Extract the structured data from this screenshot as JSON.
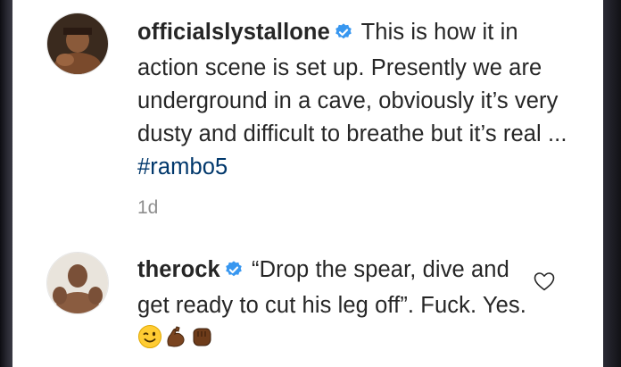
{
  "comments": [
    {
      "username": "officialslystallone",
      "text": "This is how it in action scene is set up. Presently we are underground in a cave, obviously it’s very dusty and difficult to breathe but it’s real ...",
      "hashtag": "#rambo5",
      "time": "1d"
    },
    {
      "username": "therock",
      "text": "“Drop the spear, dive and get ready to cut his leg off”. Fuck. Yes.",
      "emojis": [
        "winking-face-emoji",
        "flexed-biceps-emoji",
        "oncoming-fist-emoji"
      ]
    }
  ],
  "colors": {
    "verified_badge": "#3897f0",
    "hashtag": "#00376b",
    "timestamp": "#8e8e8e",
    "text": "#262626"
  },
  "icons": {
    "verified": "verified-badge-icon",
    "like": "heart-outline-icon"
  }
}
